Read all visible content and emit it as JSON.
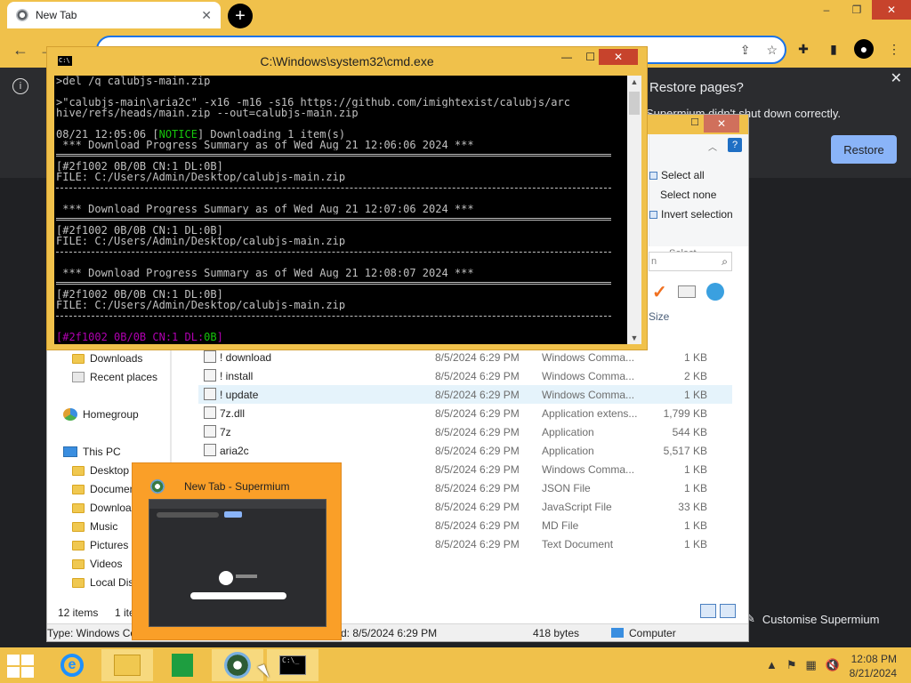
{
  "browser": {
    "tab_title": "New Tab",
    "tab_close": "✕",
    "new_tab": "+",
    "controls": {
      "min": "–",
      "max": "❐",
      "close": "✕"
    },
    "restore": {
      "title": "Restore pages?",
      "message": "Supermium didn't shut down correctly.",
      "button": "Restore",
      "close": "✕"
    },
    "customise_label": "Customise Supermium"
  },
  "cmd": {
    "title": "C:\\Windows\\system32\\cmd.exe",
    "lines": [
      {
        "t": ">del /q calubjs-main.zip"
      },
      {
        "t": ""
      },
      {
        "t": ">\"calubjs-main\\aria2c\" -x16 -m16 -s16 https://github.com/imightexist/calubjs/arc"
      },
      {
        "t": "hive/refs/heads/main.zip --out=calubjs-main.zip"
      },
      {
        "t": ""
      },
      {
        "t": "08/21 12:05:06 [",
        "notice": "NOTICE",
        "t2": "] Downloading 1 item(s)"
      },
      {
        "t": " *** Download Progress Summary as of Wed Aug 21 12:06:06 2024 ***"
      },
      {
        "sep": "double"
      },
      {
        "t": "[#2f1002 0B/0B CN:1 DL:0B]"
      },
      {
        "t": "FILE: C:/Users/Admin/Desktop/calubjs-main.zip"
      },
      {
        "sep": "single"
      },
      {
        "t": ""
      },
      {
        "t": " *** Download Progress Summary as of Wed Aug 21 12:07:06 2024 ***"
      },
      {
        "sep": "double"
      },
      {
        "t": "[#2f1002 0B/0B CN:1 DL:0B]"
      },
      {
        "t": "FILE: C:/Users/Admin/Desktop/calubjs-main.zip"
      },
      {
        "sep": "single"
      },
      {
        "t": ""
      },
      {
        "t": " *** Download Progress Summary as of Wed Aug 21 12:08:07 2024 ***"
      },
      {
        "sep": "double"
      },
      {
        "t": "[#2f1002 0B/0B CN:1 DL:0B]"
      },
      {
        "t": "FILE: C:/Users/Admin/Desktop/calubjs-main.zip"
      },
      {
        "sep": "single"
      },
      {
        "t": ""
      },
      {
        "live": true,
        "a": "[#2f1002 0B/0B CN:1 DL:",
        "b": "0B",
        "c": "]"
      }
    ]
  },
  "explorer": {
    "ribbon": {
      "select_all": "Select all",
      "select_none": "Select none",
      "invert_selection": "Invert selection",
      "group": "Select"
    },
    "search_fragment": "n",
    "column_size": "Size",
    "nav": [
      {
        "label": "Downloads",
        "icon": "folder"
      },
      {
        "label": "Recent places",
        "icon": "recent"
      },
      {
        "label": "Homegroup",
        "icon": "home"
      },
      {
        "label": "This PC",
        "icon": "pc"
      },
      {
        "label": "Desktop",
        "icon": "folder"
      },
      {
        "label": "Documen",
        "icon": "folder"
      },
      {
        "label": "Downloa",
        "icon": "folder"
      },
      {
        "label": "Music",
        "icon": "folder"
      },
      {
        "label": "Pictures",
        "icon": "folder"
      },
      {
        "label": "Videos",
        "icon": "folder"
      },
      {
        "label": "Local Dis",
        "icon": "folder"
      }
    ],
    "files": [
      {
        "name": "! download",
        "date": "8/5/2024 6:29 PM",
        "type": "Windows Comma...",
        "size": "1 KB"
      },
      {
        "name": "! install",
        "date": "8/5/2024 6:29 PM",
        "type": "Windows Comma...",
        "size": "2 KB"
      },
      {
        "name": "! update",
        "date": "8/5/2024 6:29 PM",
        "type": "Windows Comma...",
        "size": "1 KB",
        "hl": true
      },
      {
        "name": "7z.dll",
        "date": "8/5/2024 6:29 PM",
        "type": "Application extens...",
        "size": "1,799 KB"
      },
      {
        "name": "7z",
        "date": "8/5/2024 6:29 PM",
        "type": "Application",
        "size": "544 KB"
      },
      {
        "name": "aria2c",
        "date": "8/5/2024 6:29 PM",
        "type": "Application",
        "size": "5,517 KB"
      },
      {
        "name": "",
        "date": "8/5/2024 6:29 PM",
        "type": "Windows Comma...",
        "size": "1 KB"
      },
      {
        "name": "",
        "date": "8/5/2024 6:29 PM",
        "type": "JSON File",
        "size": "1 KB"
      },
      {
        "name": "",
        "date": "8/5/2024 6:29 PM",
        "type": "JavaScript File",
        "size": "33 KB"
      },
      {
        "name": "",
        "date": "8/5/2024 6:29 PM",
        "type": "MD File",
        "size": "1 KB"
      },
      {
        "name": "",
        "date": "8/5/2024 6:29 PM",
        "type": "Text Document",
        "size": "1 KB"
      }
    ],
    "status_items": "12 items",
    "status_selected": "1 ite",
    "detail": {
      "type": "Type: Windows Co",
      "date": "d: 8/5/2024 6:29 PM",
      "size": "418 bytes",
      "location": "Computer"
    }
  },
  "preview": {
    "title": "New Tab - Supermium"
  },
  "taskbar": {
    "time": "12:08 PM",
    "date": "8/21/2024"
  }
}
